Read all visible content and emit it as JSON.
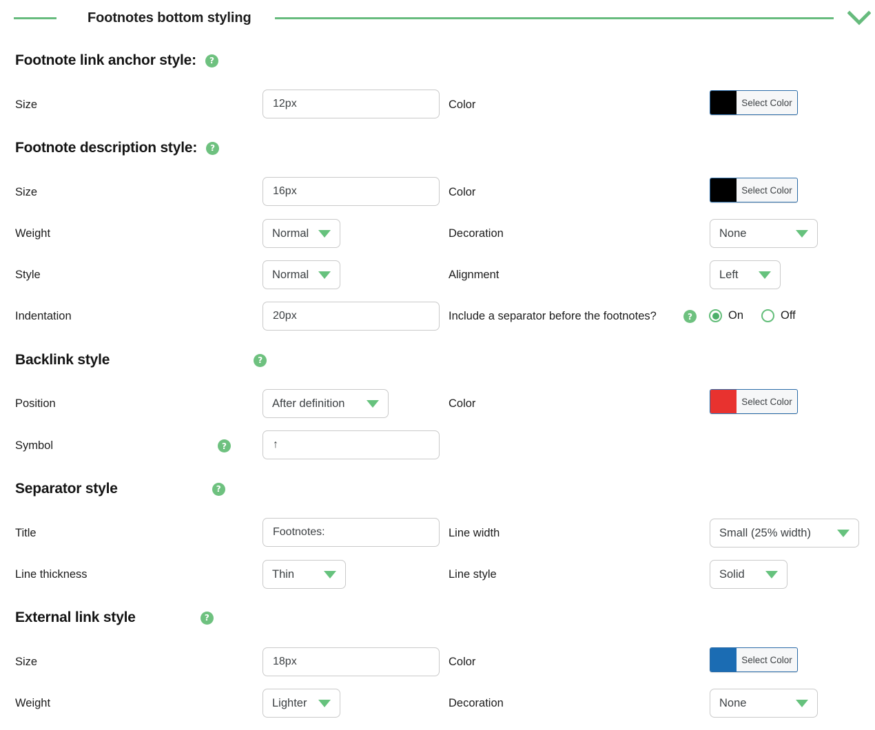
{
  "section": {
    "title": "Footnotes bottom styling",
    "collapse_icon": "chevron-down-icon",
    "accent_color": "#66bb7d"
  },
  "groups": {
    "anchor": {
      "heading": "Footnote link anchor style:",
      "help": "?",
      "size_label": "Size",
      "size_value": "12px",
      "color_label": "Color",
      "color_button_label": "Select Color",
      "color_swatch": "#000000"
    },
    "description": {
      "heading": "Footnote description style:",
      "help": "?",
      "size_label": "Size",
      "size_value": "16px",
      "color_label": "Color",
      "color_button_label": "Select Color",
      "color_swatch": "#000000",
      "weight_label": "Weight",
      "weight_value": "Normal",
      "decoration_label": "Decoration",
      "decoration_value": "None",
      "style_label": "Style",
      "style_value": "Normal",
      "alignment_label": "Alignment",
      "alignment_value": "Left",
      "indentation_label": "Indentation",
      "indentation_value": "20px",
      "separator_question": "Include a separator before the footnotes?",
      "separator_help": "?",
      "separator_on_label": "On",
      "separator_off_label": "Off",
      "separator_selected": "On"
    },
    "backlink": {
      "heading": "Backlink style",
      "help": "?",
      "position_label": "Position",
      "position_value": "After definition",
      "color_label": "Color",
      "color_button_label": "Select Color",
      "color_swatch": "#e8322f",
      "symbol_label": "Symbol",
      "symbol_help": "?",
      "symbol_value": "↑"
    },
    "separator": {
      "heading": "Separator style",
      "help": "?",
      "title_label": "Title",
      "title_value": "Footnotes:",
      "line_width_label": "Line width",
      "line_width_value": "Small (25% width)",
      "line_thickness_label": "Line thickness",
      "line_thickness_value": "Thin",
      "line_style_label": "Line style",
      "line_style_value": "Solid"
    },
    "external": {
      "heading": "External link style",
      "help": "?",
      "size_label": "Size",
      "size_value": "18px",
      "color_label": "Color",
      "color_button_label": "Select Color",
      "color_swatch": "#1b6cb3",
      "weight_label": "Weight",
      "weight_value": "Lighter",
      "decoration_label": "Decoration",
      "decoration_value": "None"
    }
  }
}
